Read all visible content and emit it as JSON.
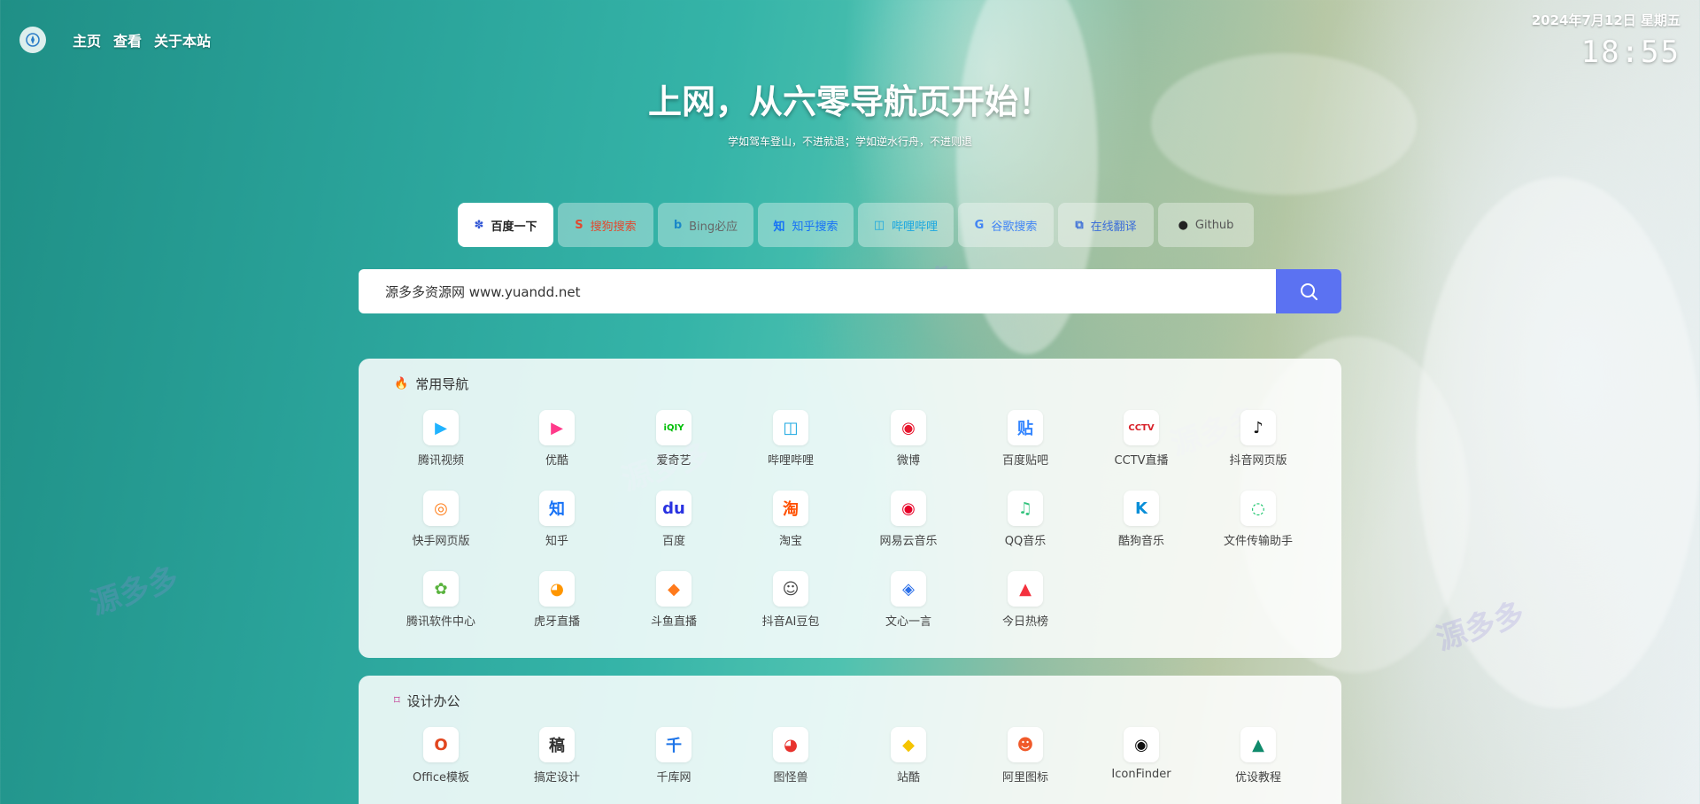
{
  "nav": {
    "home": "主页",
    "view": "查看",
    "about": "关于本站"
  },
  "clock": {
    "date": "2024年7月12日 星期五",
    "time": "18:55"
  },
  "hero": {
    "title": "上网，从六零导航页开始！",
    "subtitle": "学如驾车登山，不进就退；学如逆水行舟，不进则退"
  },
  "engines": [
    {
      "label": "百度一下",
      "icon": "baidu-paw-icon",
      "color": "#3458d6",
      "glyph": "✽"
    },
    {
      "label": "搜狗搜索",
      "icon": "sogou-icon",
      "color": "#e2492f",
      "glyph": "S"
    },
    {
      "label": "Bing必应",
      "icon": "bing-icon",
      "color": "#1b88c8",
      "glyph": "b"
    },
    {
      "label": "知乎搜索",
      "icon": "zhihu-icon",
      "color": "#1772f6",
      "glyph": "知"
    },
    {
      "label": "哔哩哔哩",
      "icon": "bilibili-icon",
      "color": "#1aa7e0",
      "glyph": "◫"
    },
    {
      "label": "谷歌搜索",
      "icon": "google-icon",
      "color": "#4285f4",
      "glyph": "G"
    },
    {
      "label": "在线翻译",
      "icon": "translate-icon",
      "color": "#3d6fd8",
      "glyph": "⧉"
    },
    {
      "label": "Github",
      "icon": "github-icon",
      "color": "#222222",
      "glyph": "●"
    }
  ],
  "search": {
    "value": "源多多资源网 www.yuandd.net"
  },
  "sections": [
    {
      "title": "常用导航",
      "title_icon": "flame-icon",
      "items": [
        {
          "label": "腾讯视频",
          "glyph": "▶",
          "color": "#20b3ff"
        },
        {
          "label": "优酷",
          "glyph": "▶",
          "color": "#ff3a8a"
        },
        {
          "label": "爱奇艺",
          "glyph": "iQIY",
          "color": "#00be06"
        },
        {
          "label": "哔哩哔哩",
          "glyph": "◫",
          "color": "#1aa7e0"
        },
        {
          "label": "微博",
          "glyph": "◉",
          "color": "#e6162d"
        },
        {
          "label": "百度贴吧",
          "glyph": "贴",
          "color": "#3385ff"
        },
        {
          "label": "CCTV直播",
          "glyph": "CCTV",
          "color": "#d8222a"
        },
        {
          "label": "抖音网页版",
          "glyph": "♪",
          "color": "#111111"
        },
        {
          "label": "快手网页版",
          "glyph": "◎",
          "color": "#ff7e1a"
        },
        {
          "label": "知乎",
          "glyph": "知",
          "color": "#1772f6"
        },
        {
          "label": "百度",
          "glyph": "du",
          "color": "#2932e1"
        },
        {
          "label": "淘宝",
          "glyph": "淘",
          "color": "#ff5000"
        },
        {
          "label": "网易云音乐",
          "glyph": "◉",
          "color": "#e60026"
        },
        {
          "label": "QQ音乐",
          "glyph": "♫",
          "color": "#31c27c"
        },
        {
          "label": "酷狗音乐",
          "glyph": "K",
          "color": "#0a8fd8"
        },
        {
          "label": "文件传输助手",
          "glyph": "◌",
          "color": "#07c160"
        },
        {
          "label": "腾讯软件中心",
          "glyph": "✿",
          "color": "#5ab33e"
        },
        {
          "label": "虎牙直播",
          "glyph": "◕",
          "color": "#ff9600"
        },
        {
          "label": "斗鱼直播",
          "glyph": "◆",
          "color": "#ff7a1c"
        },
        {
          "label": "抖音AI豆包",
          "glyph": "☺",
          "color": "#444444"
        },
        {
          "label": "文心一言",
          "glyph": "◈",
          "color": "#2a6ee8"
        },
        {
          "label": "今日热榜",
          "glyph": "▲",
          "color": "#f4313e"
        }
      ]
    },
    {
      "title": "设计办公",
      "title_icon": "crop-icon",
      "items": [
        {
          "label": "Office模板",
          "glyph": "O",
          "color": "#e2461f"
        },
        {
          "label": "搞定设计",
          "glyph": "稿",
          "color": "#333333"
        },
        {
          "label": "千库网",
          "glyph": "千",
          "color": "#1d74e8"
        },
        {
          "label": "图怪兽",
          "glyph": "◕",
          "color": "#e8322d"
        },
        {
          "label": "站酷",
          "glyph": "◆",
          "color": "#f5c400"
        },
        {
          "label": "阿里图标",
          "glyph": "☻",
          "color": "#f05a2a"
        },
        {
          "label": "IconFinder",
          "glyph": "◉",
          "color": "#111111"
        },
        {
          "label": "优设教程",
          "glyph": "▲",
          "color": "#0f8a6b"
        }
      ]
    }
  ],
  "colors": {
    "accent": "#5b72f2",
    "card_bg": "#ffffff"
  }
}
